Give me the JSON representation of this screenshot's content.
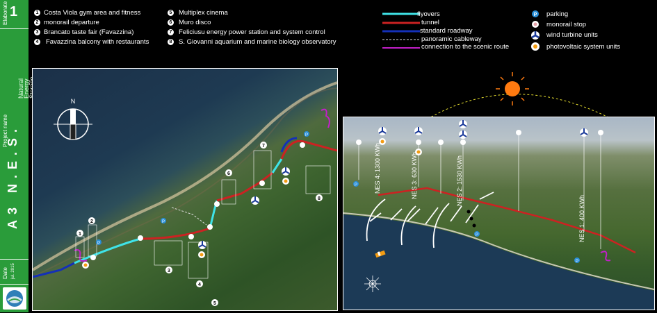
{
  "sidebar": {
    "label_elaborate": "Elaborate",
    "sheet_number": "1",
    "project_name_label": "Project name",
    "project_title": "A3 N.E.S.",
    "project_subtitle": [
      "Natural",
      "Energy",
      "Storage"
    ],
    "date_label": "Date",
    "date_value": "jul. 2015"
  },
  "numbered_legend": [
    {
      "n": "1",
      "text": "Costa Viola gym area and fitness"
    },
    {
      "n": "2",
      "text": "monorail departure"
    },
    {
      "n": "3",
      "text": "Brancato taste fair  (Favazzina)"
    },
    {
      "n": "4",
      "text": "Favazzina balcony with restaurants"
    },
    {
      "n": "5",
      "text": "Multiplex cinema"
    },
    {
      "n": "6",
      "text": "Muro disco"
    },
    {
      "n": "7",
      "text": "Feliciusu energy power station and system control"
    },
    {
      "n": "8",
      "text": "S. Giovanni aquarium and marine biology observatory"
    }
  ],
  "line_legend": [
    {
      "label": "flyovers",
      "color": "#3fe3e8",
      "style": "solid"
    },
    {
      "label": "tunnel",
      "color": "#cc2222",
      "style": "solid"
    },
    {
      "label": "standard roadway",
      "color": "#1430b8",
      "style": "solid"
    },
    {
      "label": "panoramic cableway",
      "color": "#dddddd",
      "style": "dashed"
    },
    {
      "label": "connection to the scenic route",
      "color": "#c21fc9",
      "style": "solid"
    }
  ],
  "symbol_legend": [
    {
      "label": "parking",
      "icon": "parking-icon",
      "color": "#2a8fd8"
    },
    {
      "label": "monorail stop",
      "icon": "monorail-stop-icon",
      "color": "#e0a0a0"
    },
    {
      "label": "wind turbine units",
      "icon": "wind-turbine-icon",
      "color": "#1a3a9a"
    },
    {
      "label": "photovoltaic system units",
      "icon": "photovoltaic-icon",
      "color": "#f39c12"
    }
  ],
  "left_map": {
    "markers": [
      "1",
      "2",
      "3",
      "4",
      "5",
      "6",
      "7",
      "8"
    ],
    "compass": "N"
  },
  "right_map": {
    "nes_labels": [
      "NES 4: 1300 KWh",
      "NES 3: 630 KWh",
      "NES 2: 1530 KWh",
      "NES 1: 400 KWh"
    ],
    "sun_color": "#ff7a10"
  }
}
